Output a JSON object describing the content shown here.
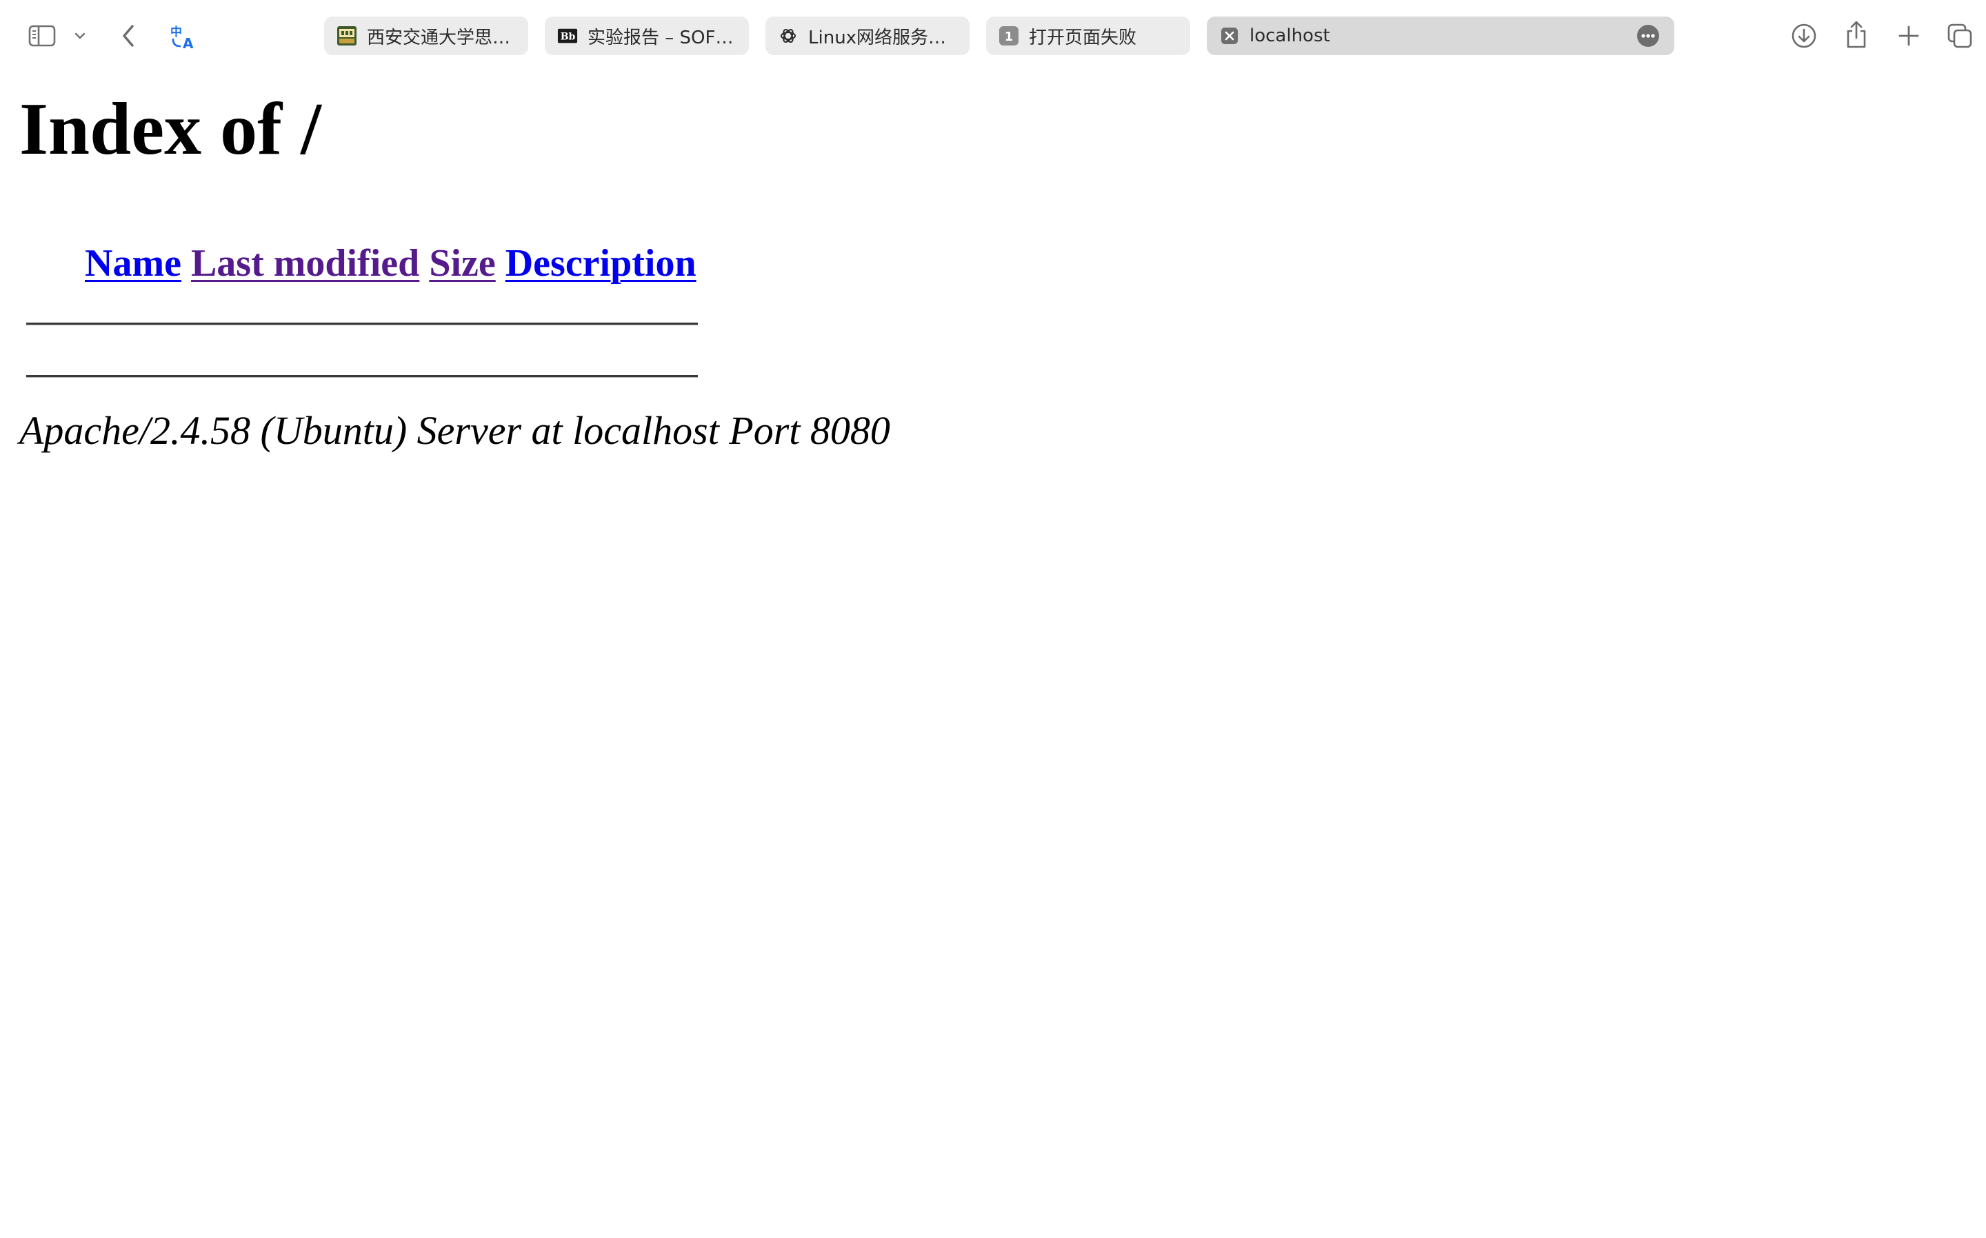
{
  "browser": {
    "toolbar": {
      "sidebar_icon": "sidebar-icon",
      "sidebar_menu_icon": "chevron-down-icon",
      "back_icon": "chevron-left-icon",
      "translate_icon": "translate-icon",
      "download_icon": "download-icon",
      "share_icon": "share-icon",
      "new_tab_icon": "plus-icon",
      "tab_overview_icon": "tab-overview-icon"
    },
    "tabs": [
      {
        "title": "西安交通大学思…",
        "active": false
      },
      {
        "title": "实验报告 – SOF…",
        "active": false
      },
      {
        "title": "Linux网络服务…",
        "active": false
      },
      {
        "title": "打开页面失败",
        "active": false,
        "favicon_text": "1"
      },
      {
        "title": "localhost",
        "active": true
      }
    ],
    "colors": {
      "active_tab_bg": "#d9d9d9",
      "inactive_tab_bg": "#ececec",
      "translate_accent": "#1a6ff0"
    }
  },
  "page": {
    "title": "Index of /",
    "columns": [
      {
        "label": "Name",
        "visited": false
      },
      {
        "label": "Last modified",
        "visited": true
      },
      {
        "label": "Size",
        "visited": true
      },
      {
        "label": "Description",
        "visited": false
      }
    ],
    "address": "Apache/2.4.58 (Ubuntu) Server at localhost Port 8080",
    "colors": {
      "link": "#0000ee",
      "visited_link": "#551a8b"
    }
  }
}
